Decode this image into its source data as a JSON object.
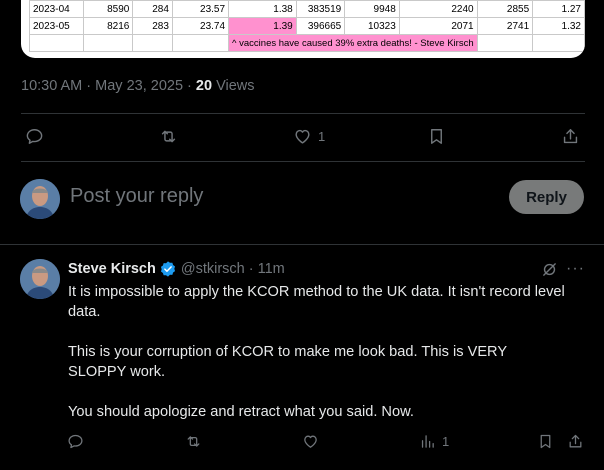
{
  "sheet": {
    "rows": [
      [
        "2023-04",
        "8590",
        "284",
        "23.57",
        "1.38",
        "383519",
        "9948",
        "2240",
        "2855",
        "1.27"
      ],
      [
        "2023-05",
        "8216",
        "283",
        "23.74",
        "1.39",
        "396665",
        "10323",
        "2071",
        "2741",
        "1.32"
      ]
    ],
    "note": "^ vaccines have caused 39% extra deaths! - Steve Kirsch"
  },
  "post_meta": {
    "time": "10:30 AM · May 23, 2025 · ",
    "views_count": "20",
    "views_label": " Views"
  },
  "post_actions": {
    "like_count": "1"
  },
  "composer": {
    "placeholder": "Post your reply",
    "reply_label": "Reply"
  },
  "reply_tweet": {
    "author": "Steve Kirsch",
    "handle": "@stkirsch · 11m",
    "paragraphs": [
      "It is impossible to apply the KCOR method to the UK data.  It isn't record level data.",
      "This is your corruption of KCOR to make me look bad. This is VERY SLOPPY work.",
      "You should apologize and retract what you said. Now."
    ],
    "more_label": "···",
    "views_count": "1"
  },
  "colors": {
    "background": "#000000",
    "muted": "#71767b",
    "verified": "#1d9bf0",
    "highlight": "#ff91cf"
  }
}
